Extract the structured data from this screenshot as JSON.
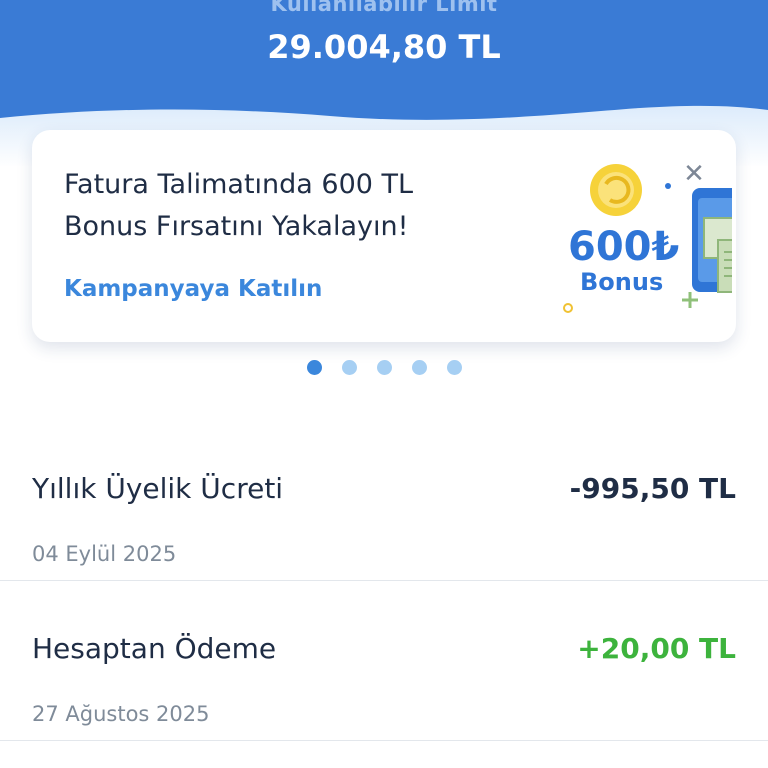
{
  "header": {
    "limit_label": "Kullanılabilir Limit",
    "limit_amount": "29.004,80 TL",
    "background_color": "#3a7bd5"
  },
  "promo": {
    "title": "Fatura Talimatında 600 TL Bonus Fırsatını Yakalayın!",
    "link": "Kampanyaya Katılın",
    "badge_amount": "600₺",
    "badge_text": "Bonus",
    "close_icon": "close-icon",
    "accent_color": "#3b87dc"
  },
  "carousel": {
    "total": 5,
    "active_index": 0
  },
  "transactions": [
    {
      "title": "Yıllık Üyelik Ücreti",
      "date": "04 Eylül 2025",
      "amount": "-995,50 TL",
      "amount_color": "#1f2d45"
    },
    {
      "title": "Hesaptan Ödeme",
      "date": "27 Ağustos 2025",
      "amount": "+20,00 TL",
      "amount_color": "#3db33d"
    }
  ]
}
